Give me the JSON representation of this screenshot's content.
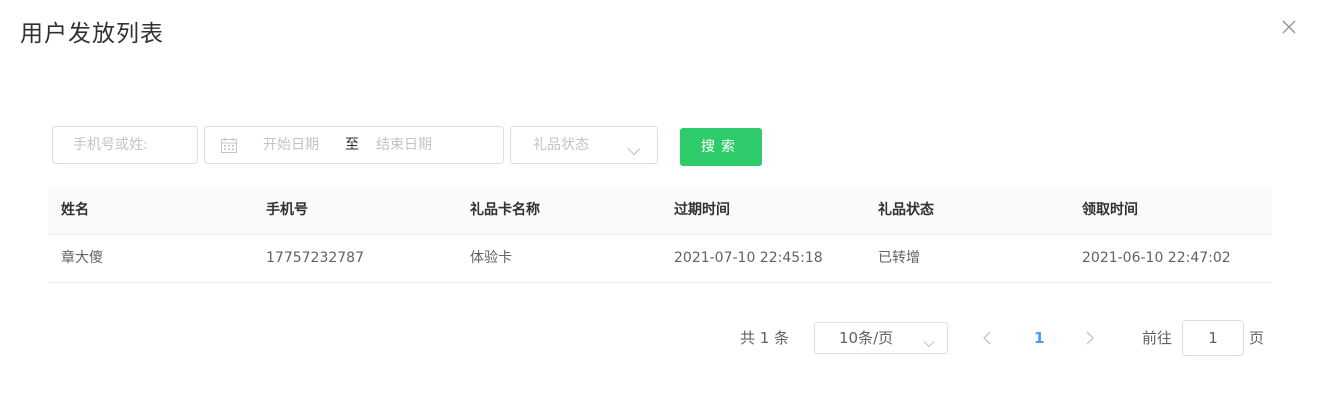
{
  "dialog": {
    "title": "用户发放列表"
  },
  "filters": {
    "phone_placeholder": "手机号或姓:",
    "start_date_placeholder": "开始日期",
    "range_separator": "至",
    "end_date_placeholder": "结束日期",
    "status_placeholder": "礼品状态",
    "search_label": "搜索"
  },
  "table": {
    "headers": [
      "姓名",
      "手机号",
      "礼品卡名称",
      "过期时间",
      "礼品状态",
      "领取时间"
    ],
    "rows": [
      [
        "章大傻",
        "17757232787",
        "体验卡",
        "2021-07-10 22:45:18",
        "已转增",
        "2021-06-10 22:47:02"
      ]
    ]
  },
  "pagination": {
    "total_text": "共 1 条",
    "page_size": "10条/页",
    "current_page": "1",
    "goto_label": "前往",
    "goto_value": "1",
    "page_unit": "页"
  },
  "colors": {
    "accent": "#2ecb6a",
    "active_page": "#409eff"
  },
  "icons": {
    "close": "close-icon",
    "calendar": "calendar-icon",
    "chevron": "chevron-down-icon",
    "prev": "chevron-left-icon",
    "next": "chevron-right-icon"
  }
}
